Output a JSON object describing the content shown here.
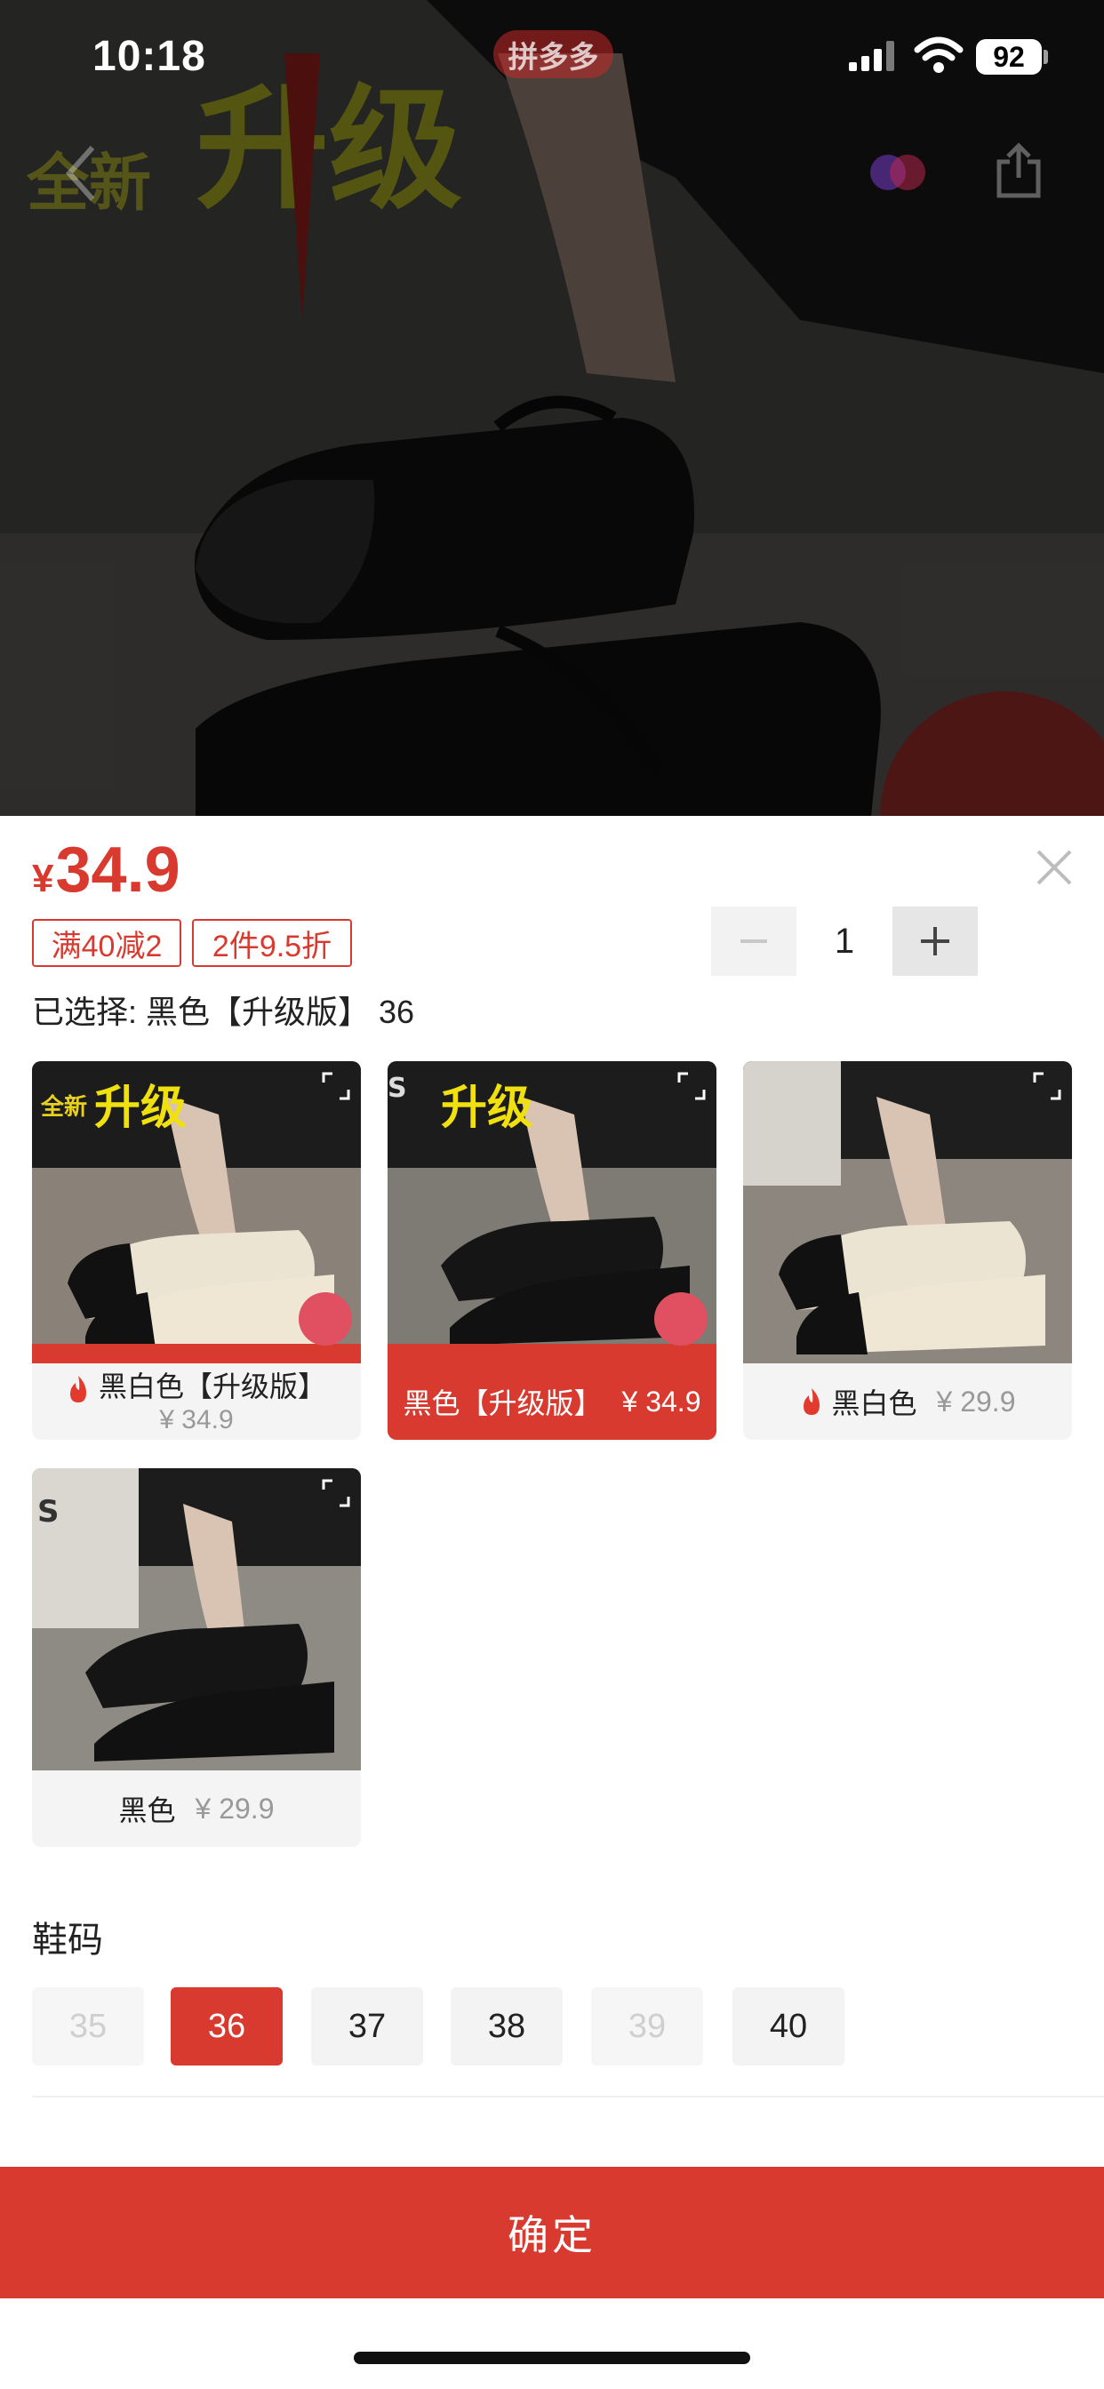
{
  "status_bar": {
    "time": "10:18",
    "battery": "92",
    "app_badge": "拼多多"
  },
  "colors": {
    "accent": "#d93a2f",
    "disabled": "#cfcfcf"
  },
  "product": {
    "currency": "¥",
    "price": "34.9",
    "promos": [
      "满40减2",
      "2件9.5折"
    ],
    "quantity": "1",
    "selected_text": "已选择: 黑色【升级版】 36"
  },
  "variants": [
    {
      "label": "黑白色【升级版】",
      "price": "¥ 34.9",
      "hot": true,
      "selected": false
    },
    {
      "label": "黑色【升级版】",
      "price": "¥ 34.9",
      "hot": false,
      "selected": true
    },
    {
      "label": "黑白色",
      "price": "¥ 29.9",
      "hot": true,
      "selected": false
    },
    {
      "label": "黑色",
      "price": "¥ 29.9",
      "hot": false,
      "selected": false
    }
  ],
  "size_section": {
    "title": "鞋码",
    "sizes": [
      {
        "label": "35",
        "state": "disabled"
      },
      {
        "label": "36",
        "state": "selected"
      },
      {
        "label": "37",
        "state": "normal"
      },
      {
        "label": "38",
        "state": "normal"
      },
      {
        "label": "39",
        "state": "disabled"
      },
      {
        "label": "40",
        "state": "normal"
      }
    ]
  },
  "confirm_button": "确定",
  "icons": {
    "back": "chevron-left-icon",
    "share": "share-icon",
    "close": "close-icon",
    "expand": "expand-icon",
    "hot": "fire-icon",
    "signal": "signal-icon",
    "wifi": "wifi-icon"
  }
}
